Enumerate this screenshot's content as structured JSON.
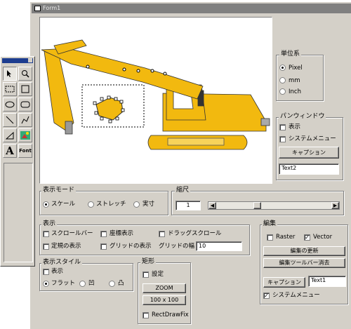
{
  "window": {
    "title": "Form1"
  },
  "tools": [
    {
      "icon": "pointer-icon"
    },
    {
      "icon": "zoom-icon"
    },
    {
      "icon": "select-rect-icon"
    },
    {
      "icon": "rectangle-icon"
    },
    {
      "icon": "ellipse-icon"
    },
    {
      "icon": "rounded-rect-icon"
    },
    {
      "icon": "line-icon"
    },
    {
      "icon": "polyline-icon"
    },
    {
      "icon": "polygon-icon"
    },
    {
      "icon": "image-icon"
    },
    {
      "icon": "text-icon",
      "glyph": "A"
    },
    {
      "icon": "font-icon",
      "label": "Font"
    }
  ],
  "units": {
    "title": "単位系",
    "options": [
      "Pixel",
      "mm",
      "Inch"
    ],
    "selected": "Pixel"
  },
  "pan_window": {
    "title": "パンウィンドウ",
    "show_label": "表示",
    "system_menu_label": "システムメニュー",
    "caption_button": "キャプション",
    "caption_value": "Text2"
  },
  "display_mode": {
    "title": "表示モード",
    "options": [
      "スケール",
      "ストレッチ",
      "実寸"
    ],
    "selected": "スケール"
  },
  "scale": {
    "title": "縮尺",
    "value": "1"
  },
  "display": {
    "title": "表示",
    "scrollbar": "スクロールバー",
    "coords": "座標表示",
    "drag_scroll": "ドラッグスクロール",
    "ruler": "定規の表示",
    "grid": "グリッドの表示",
    "grid_width_label": "グリッドの幅",
    "grid_width_value": "10"
  },
  "display_style": {
    "title": "表示スタイル",
    "show_label": "表示",
    "options": [
      "フラット",
      "凹",
      "凸"
    ],
    "selected": "フラット"
  },
  "rect": {
    "title": "矩形",
    "setting_label": "設定",
    "zoom_button": "ZOOM",
    "size_button": "100 x 100",
    "rectdrawfix_label": "RectDrawFix"
  },
  "edit": {
    "title": "編集",
    "raster_label": "Raster",
    "vector_label": "Vector",
    "raster_checked": false,
    "vector_checked": true,
    "update_button": "編集の更新",
    "hide_toolbar_button": "編集ツールバー消去",
    "caption_button": "キャプション",
    "caption_value": "Text1",
    "system_menu_label": "システムメニュー",
    "system_menu_checked": true
  },
  "colors": {
    "excavator_yellow": "#f2b90f",
    "titlebar": "#808080",
    "face": "#d4d0c8"
  }
}
